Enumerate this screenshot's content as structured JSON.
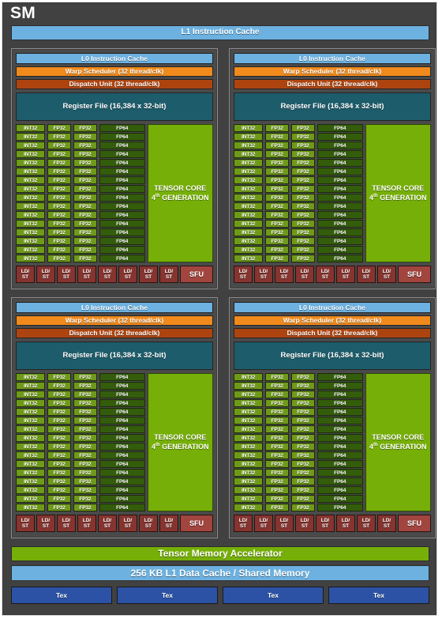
{
  "diagram": {
    "title": "SM",
    "l1_instruction_cache": "L1 Instruction Cache",
    "tensor_memory_accelerator": "Tensor Memory Accelerator",
    "l1_data_cache": "256 KB L1 Data Cache / Shared Memory",
    "tex_units": [
      "Tex",
      "Tex",
      "Tex",
      "Tex"
    ]
  },
  "processing_block": {
    "l0_instruction_cache": "L0 Instruction Cache",
    "warp_scheduler": "Warp Scheduler (32 thread/clk)",
    "dispatch_unit": "Dispatch Unit (32 thread/clk)",
    "register_file": "Register File (16,384 x 32-bit)",
    "int32_label": "INT32",
    "fp32_label": "FP32",
    "fp64_label": "FP64",
    "tensor_core_line1": "TENSOR CORE",
    "tensor_core_gen_number": "4",
    "tensor_core_gen_suffix": "th",
    "tensor_core_line2": "GENERATION",
    "ldst_line1": "LD/",
    "ldst_line2": "ST",
    "sfu_label": "SFU",
    "core_rows": 16,
    "int32_per_row": 1,
    "fp32_per_row": 2,
    "fp64_per_row": 1,
    "ldst_count": 8,
    "sfu_count": 1
  },
  "blocks": [
    {
      "id": "top-left"
    },
    {
      "id": "top-right"
    },
    {
      "id": "bottom-left"
    },
    {
      "id": "bottom-right"
    }
  ],
  "colors": {
    "chassis": "#414141",
    "processing_block_bg": "#4a4a4a",
    "cache_blue": "#6cb1e0",
    "warp_orange": "#f08a1c",
    "dispatch_brown": "#ad4410",
    "register_teal": "#1d5c6b",
    "int32_green": "#6f9a18",
    "fp32_green": "#6f9a18",
    "fp64_green": "#335c0b",
    "tensor_green": "#76af07",
    "ldst_red": "#86342f",
    "sfu_red": "#a2453f",
    "tex_blue": "#2b52a4"
  }
}
